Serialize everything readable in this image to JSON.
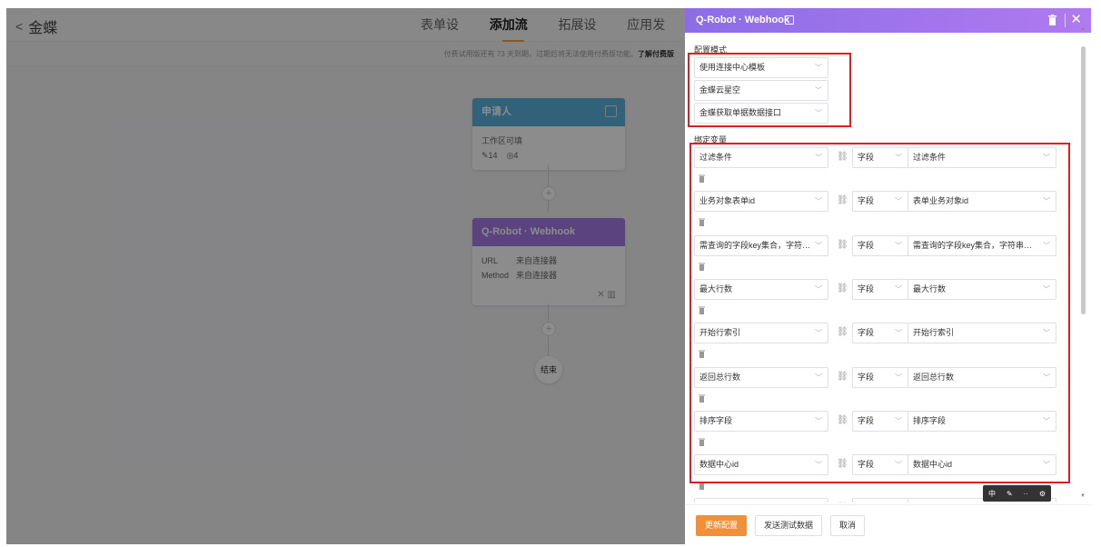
{
  "app": {
    "back_label": "金蝶",
    "tabs": [
      "表单设计",
      "添加流程",
      "拓展设置",
      "应用发布"
    ],
    "active_tab": "添加流程",
    "notice_text": "付费试用版还有 73 天到期，过期后将无法使用付费版功能。",
    "notice_link": "了解付费版"
  },
  "flow": {
    "applicant_node": {
      "title": "申请人",
      "line1": "工作区可填",
      "edit_count": "14",
      "view_count": "4"
    },
    "webhook_node": {
      "title": "Q-Robot · Webhook",
      "rows": [
        {
          "key": "URL",
          "value": "来自连接器"
        },
        {
          "key": "Method",
          "value": "来自连接器"
        }
      ]
    },
    "end_label": "结束"
  },
  "panel": {
    "title": "Q-Robot · Webhook",
    "config_mode_label": "配置模式",
    "config_selects": [
      "使用连接中心模板",
      "金蝶云星空",
      "金蝶获取单据数据接口"
    ],
    "bind_label": "绑定变量",
    "bindings": [
      {
        "param": "过滤条件",
        "type": "字段",
        "field": "过滤条件"
      },
      {
        "param": "业务对象表单id",
        "type": "字段",
        "field": "表单业务对象id"
      },
      {
        "param": "需查询的字段key集合，字符串类型",
        "type": "字段",
        "field": "需查询的字段key集合，字符串类型"
      },
      {
        "param": "最大行数",
        "type": "字段",
        "field": "最大行数"
      },
      {
        "param": "开始行索引",
        "type": "字段",
        "field": "开始行索引"
      },
      {
        "param": "返回总行数",
        "type": "字段",
        "field": "返回总行数"
      },
      {
        "param": "排序字段",
        "type": "字段",
        "field": "排序字段"
      },
      {
        "param": "数据中心id",
        "type": "字段",
        "field": "数据中心id"
      }
    ],
    "mini_toolbar": [
      "中",
      "✎",
      "··",
      "⚙"
    ],
    "buttons": {
      "update": "更新配置",
      "send_test": "发送测试数据",
      "cancel": "取消"
    }
  },
  "colors": {
    "accent": "#f0913a",
    "header_purple": "#9a73ea",
    "highlight_red": "#e02020"
  }
}
